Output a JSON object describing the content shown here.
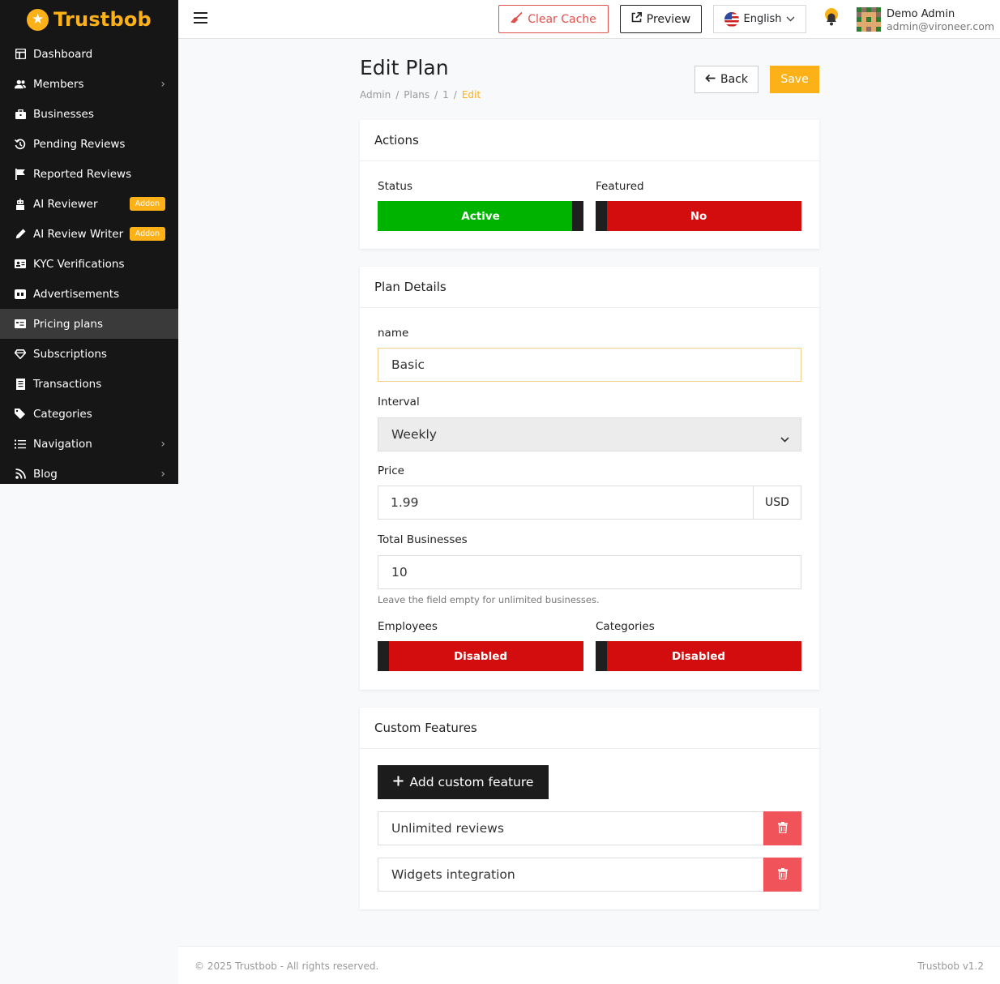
{
  "brand": {
    "name": "Trustbob"
  },
  "sidebar": {
    "items": [
      {
        "label": "Dashboard",
        "icon": "dashboard-icon"
      },
      {
        "label": "Members",
        "icon": "users-icon",
        "has_children": true
      },
      {
        "label": "Businesses",
        "icon": "briefcase-icon"
      },
      {
        "label": "Pending Reviews",
        "icon": "history-icon"
      },
      {
        "label": "Reported Reviews",
        "icon": "flag-icon"
      },
      {
        "label": "AI Reviewer",
        "icon": "robot-icon",
        "badge": "Addon"
      },
      {
        "label": "AI Review Writer",
        "icon": "pen-icon",
        "badge": "Addon"
      },
      {
        "label": "KYC Verifications",
        "icon": "id-card-icon"
      },
      {
        "label": "Advertisements",
        "icon": "ad-icon"
      },
      {
        "label": "Pricing plans",
        "icon": "pricing-icon",
        "active": true
      },
      {
        "label": "Subscriptions",
        "icon": "gem-icon"
      },
      {
        "label": "Transactions",
        "icon": "receipt-icon"
      },
      {
        "label": "Categories",
        "icon": "tags-icon"
      },
      {
        "label": "Navigation",
        "icon": "list-icon",
        "has_children": true
      },
      {
        "label": "Blog",
        "icon": "rss-icon",
        "has_children": true
      }
    ]
  },
  "topbar": {
    "clear_cache": "Clear Cache",
    "preview": "Preview",
    "language": "English",
    "user_name": "Demo Admin",
    "user_email": "admin@vironeer.com"
  },
  "page": {
    "title": "Edit Plan",
    "breadcrumb": [
      "Admin",
      "Plans",
      "1",
      "Edit"
    ],
    "back": "Back",
    "save": "Save"
  },
  "actions": {
    "title": "Actions",
    "status_label": "Status",
    "status_value": "Active",
    "featured_label": "Featured",
    "featured_value": "No"
  },
  "details": {
    "title": "Plan Details",
    "name_label": "name",
    "name_value": "Basic",
    "interval_label": "Interval",
    "interval_value": "Weekly",
    "price_label": "Price",
    "price_value": "1.99",
    "currency": "USD",
    "total_label": "Total Businesses",
    "total_value": "10",
    "total_hint": "Leave the field empty for unlimited businesses.",
    "employees_label": "Employees",
    "employees_value": "Disabled",
    "categories_label": "Categories",
    "categories_value": "Disabled"
  },
  "custom": {
    "title": "Custom Features",
    "add_label": "Add custom feature",
    "features": [
      "Unlimited reviews",
      "Widgets integration"
    ]
  },
  "footer": {
    "copyright": "© 2025 Trustbob - All rights reserved.",
    "version": "Trustbob v1.2"
  },
  "colors": {
    "accent": "#fbb117",
    "active_green": "#00b300",
    "disabled_red": "#d30d0d",
    "danger": "#f0545a",
    "sidebar_bg": "#161616"
  }
}
